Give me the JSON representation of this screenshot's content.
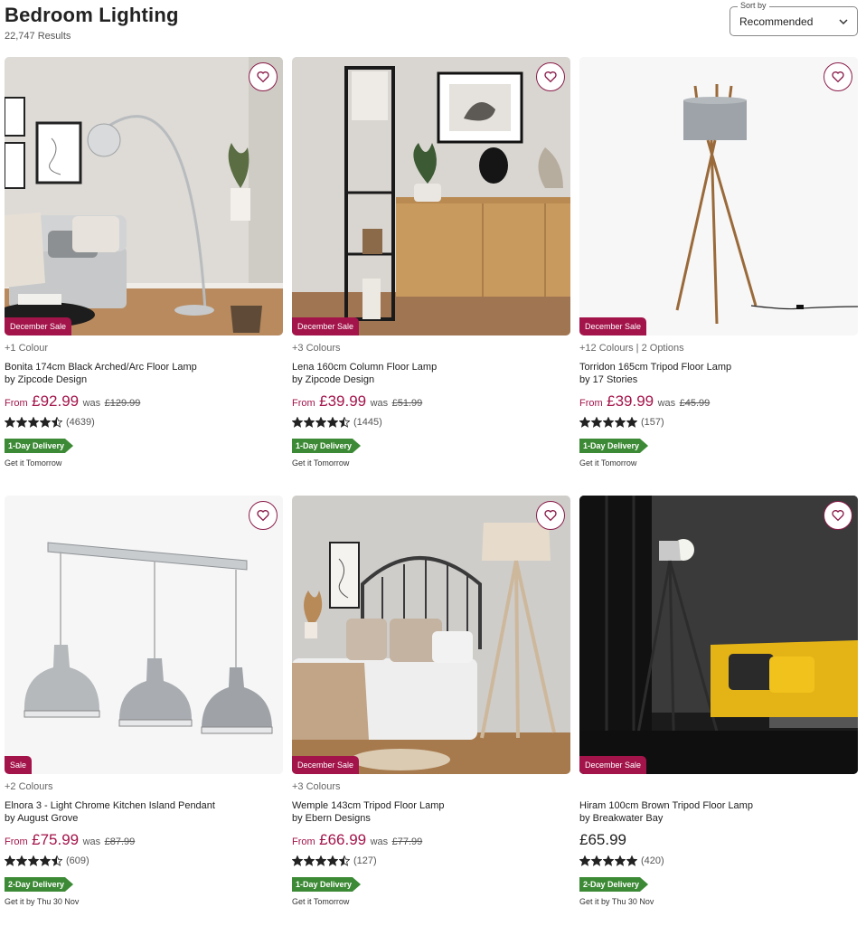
{
  "header": {
    "title": "Bedroom Lighting",
    "results": "22,747 Results"
  },
  "sort": {
    "label": "Sort by",
    "value": "Recommended"
  },
  "products": [
    {
      "badge": "December Sale",
      "options": "+1 Colour",
      "name_line1": "Bonita 174cm Black Arched/Arc Floor Lamp",
      "name_line2": "by Zipcode Design",
      "from": "From",
      "price": "£92.99",
      "was": "was",
      "was_price": "£129.99",
      "rating": 4.5,
      "reviews": "(4639)",
      "delivery": "1-Day Delivery",
      "delivery_when": "Get it Tomorrow"
    },
    {
      "badge": "December Sale",
      "options": "+3 Colours",
      "name_line1": "Lena 160cm Column Floor Lamp",
      "name_line2": "by Zipcode Design",
      "from": "From",
      "price": "£39.99",
      "was": "was",
      "was_price": "£51.99",
      "rating": 4.5,
      "reviews": "(1445)",
      "delivery": "1-Day Delivery",
      "delivery_when": "Get it Tomorrow"
    },
    {
      "badge": "December Sale",
      "options": "+12 Colours | 2 Options",
      "name_line1": "Torridon 165cm Tripod Floor Lamp",
      "name_line2": "by 17 Stories",
      "from": "From",
      "price": "£39.99",
      "was": "was",
      "was_price": "£45.99",
      "rating": 5,
      "reviews": "(157)",
      "delivery": "1-Day Delivery",
      "delivery_when": "Get it Tomorrow"
    },
    {
      "badge": "Sale",
      "options": "+2 Colours",
      "name_line1": "Elnora 3 - Light Chrome Kitchen Island Pendant",
      "name_line2": "by August Grove",
      "from": "From",
      "price": "£75.99",
      "was": "was",
      "was_price": "£87.99",
      "rating": 4.5,
      "reviews": "(609)",
      "delivery": "2-Day Delivery",
      "delivery_when": "Get it by Thu 30 Nov"
    },
    {
      "badge": "December Sale",
      "options": "+3 Colours",
      "name_line1": "Wemple 143cm Tripod Floor Lamp",
      "name_line2": "by Ebern Designs",
      "from": "From",
      "price": "£66.99",
      "was": "was",
      "was_price": "£77.99",
      "rating": 4.5,
      "reviews": "(127)",
      "delivery": "1-Day Delivery",
      "delivery_when": "Get it Tomorrow"
    },
    {
      "badge": "December Sale",
      "options": "",
      "name_line1": "Hiram 100cm Brown Tripod Floor Lamp",
      "name_line2": "by Breakwater Bay",
      "from": "",
      "price": "£65.99",
      "was": "",
      "was_price": "",
      "rating": 5,
      "reviews": "(420)",
      "delivery": "2-Day Delivery",
      "delivery_when": "Get it by Thu 30 Nov"
    }
  ],
  "colors": {
    "brand": "#a3144a",
    "delivery_green": "#3c8a35"
  },
  "icons": {
    "favourite": "heart-icon",
    "sort": "chevron-down-icon",
    "rating": "star-icon"
  }
}
